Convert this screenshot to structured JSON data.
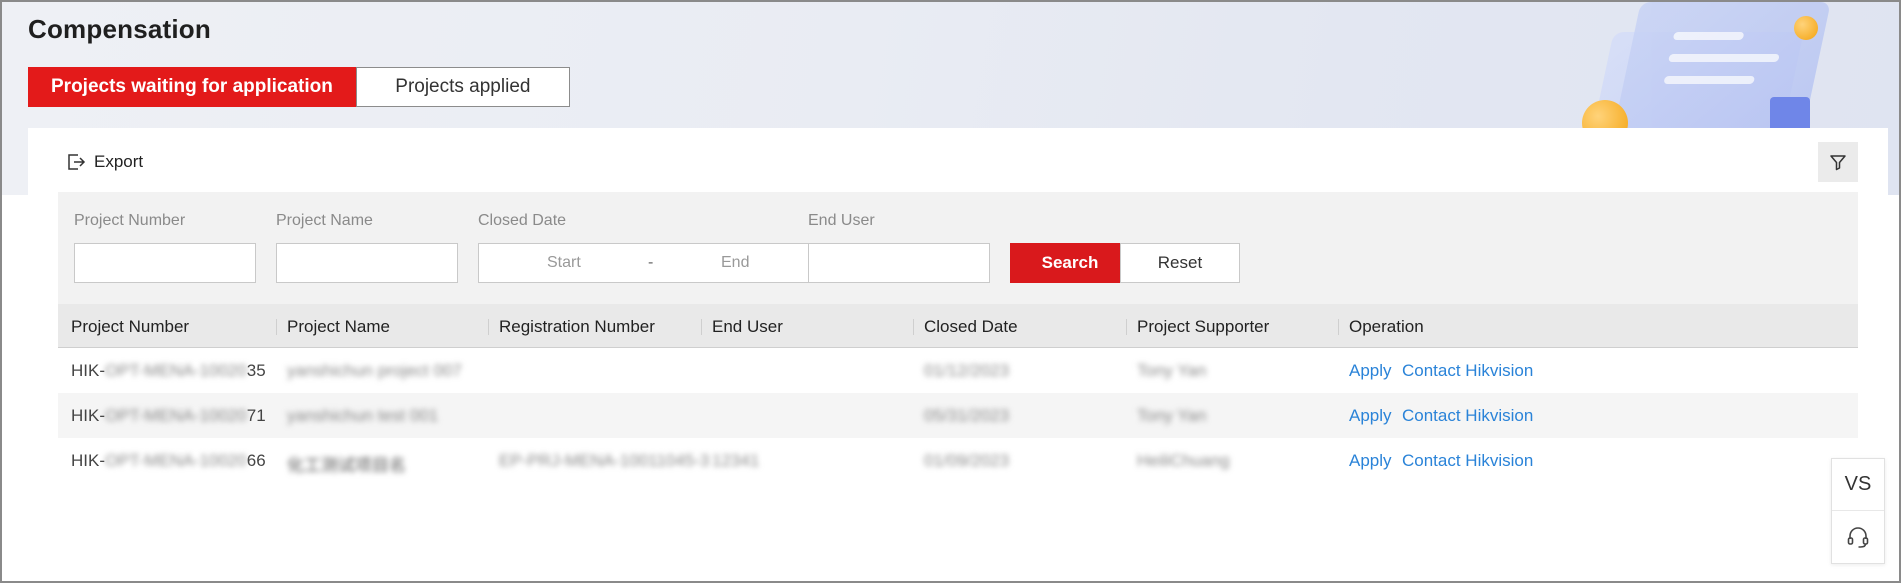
{
  "page": {
    "title": "Compensation"
  },
  "tabs": [
    {
      "label": "Projects waiting for application",
      "active": true
    },
    {
      "label": "Projects applied",
      "active": false
    }
  ],
  "toolbar": {
    "export_label": "Export",
    "export_icon": "export-icon",
    "filter_icon": "filter-icon"
  },
  "search": {
    "project_number_label": "Project Number",
    "project_number_value": "",
    "project_name_label": "Project Name",
    "project_name_value": "",
    "closed_date_label": "Closed Date",
    "start_placeholder": "Start",
    "separator": "-",
    "end_placeholder": "End",
    "end_user_label": "End User",
    "end_user_value": "",
    "search_label": "Search",
    "reset_label": "Reset"
  },
  "table": {
    "columns": [
      "Project Number",
      "Project Name",
      "Registration Number",
      "End User",
      "Closed Date",
      "Project Supporter",
      "Operation"
    ],
    "rows": [
      {
        "project_number_prefix": "HIK-",
        "project_number_hidden": "OPT-MENA-10020",
        "project_number_suffix": "35",
        "project_name": "yanshichun project 007",
        "registration_number": "",
        "end_user": "",
        "closed_date": "01/12/2023",
        "project_supporter": "Tony Yan",
        "apply_label": "Apply",
        "contact_label": "Contact Hikvision"
      },
      {
        "project_number_prefix": "HIK-",
        "project_number_hidden": "OPT-MENA-10020",
        "project_number_suffix": "71",
        "project_name": "yanshichun test 001",
        "registration_number": "",
        "end_user": "",
        "closed_date": "05/31/2023",
        "project_supporter": "Tony Yan",
        "apply_label": "Apply",
        "contact_label": "Contact Hikvision"
      },
      {
        "project_number_prefix": "HIK-",
        "project_number_hidden": "OPT-MENA-10020",
        "project_number_suffix": "66",
        "project_name": "化工测试项目名",
        "registration_number": "EP-PRJ-MENA-10011045-3",
        "end_user": "12341",
        "closed_date": "01/09/2023",
        "project_supporter": "HeiliChuang",
        "apply_label": "Apply",
        "contact_label": "Contact Hikvision"
      }
    ]
  },
  "side_widget": {
    "vs_label": "VS",
    "support_icon": "headset-icon"
  },
  "colors": {
    "accent": "#e31a1a",
    "link": "#2a83d8"
  }
}
